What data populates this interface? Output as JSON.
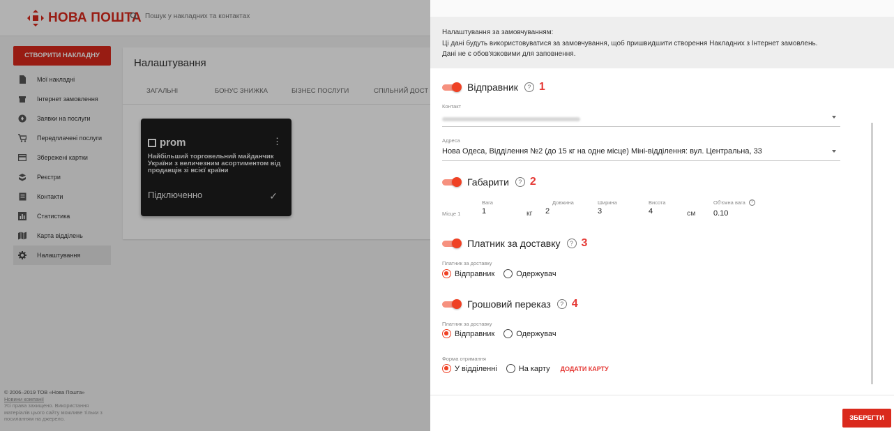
{
  "app": {
    "logo_text": "НОВА ПОШТА",
    "search_placeholder": "Пошук у накладних та контактах",
    "brand_color": "#da291c"
  },
  "sidebar": {
    "create_button": "СТВОРИТИ НАКЛАДНУ",
    "items": [
      {
        "label": "Мої накладні",
        "icon": "document-icon"
      },
      {
        "label": "Інтернет замовлення",
        "icon": "cart-icon"
      },
      {
        "label": "Заявки на послуги",
        "icon": "services-icon"
      },
      {
        "label": "Передплачені послуги",
        "icon": "shopping-cart-icon"
      },
      {
        "label": "Збережені картки",
        "icon": "credit-card-icon"
      },
      {
        "label": "Реєстри",
        "icon": "registry-icon"
      },
      {
        "label": "Контакти",
        "icon": "contacts-icon"
      },
      {
        "label": "Статистика",
        "icon": "chart-icon"
      },
      {
        "label": "Карта відділень",
        "icon": "map-icon"
      },
      {
        "label": "Налаштування",
        "icon": "gear-icon",
        "active": true
      }
    ],
    "footer": {
      "copyright": "© 2006–2019 ТОВ «Нова Пошта»",
      "link": "Новини компанії",
      "fine_print": "Усі права захищено. Використання матеріалів цього сайту можливе тільки з посиланням на джерело."
    }
  },
  "main": {
    "title": "Налаштування",
    "tabs": [
      "ЗАГАЛЬНІ",
      "БОНУС ЗНИЖКА",
      "БІЗНЕС ПОСЛУГИ",
      "СПІЛЬНИЙ ДОСТ"
    ],
    "card": {
      "logo": "prom",
      "description": "Найбільший торговельний майданчик України з величезним асортиментом від продавців зі всієї країни",
      "status": "Підключенно"
    }
  },
  "panel": {
    "info_title": "Налаштування за замовчуванням:",
    "info_text_1": "Ці дані будуть використовуватися за замовчування, щоб пришвидшити створення Накладних з Інтернет замовлень.",
    "info_text_2": "Дані не є обов'язковими для заповнення.",
    "sender": {
      "title": "Відправник",
      "number": "1",
      "contact_label": "Контакт",
      "address_label": "Адреса",
      "address_value": "Нова Одеса, Відділення №2 (до 15 кг на одне місце) Міні-відділення: вул. Центральна, 33"
    },
    "dimensions": {
      "title": "Габарити",
      "number": "2",
      "row_label": "Місце 1",
      "weight_label": "Вага",
      "weight": "1",
      "weight_unit": "кг",
      "length_label": "Довжина",
      "length": "2",
      "width_label": "Ширина",
      "width": "3",
      "height_label": "Висота",
      "height": "4",
      "size_unit": "см",
      "volume_label": "Об'ємна вага",
      "volume": "0.10"
    },
    "payer": {
      "title": "Платник за доставку",
      "number": "3",
      "label": "Платник за доставку",
      "options": [
        "Відправник",
        "Одержувач"
      ],
      "selected": "Відправник"
    },
    "money_transfer": {
      "title": "Грошовий переказ",
      "number": "4",
      "payer_label": "Платник за доставку",
      "payer_options": [
        "Відправник",
        "Одержувач"
      ],
      "payer_selected": "Відправник",
      "form_label": "Форма отримання",
      "form_options": [
        "У відділенні",
        "На карту"
      ],
      "form_selected": "У відділенні",
      "add_card": "ДОДАТИ КАРТУ"
    },
    "save_button": "ЗБЕРЕГТИ",
    "accent_color": "#ef4124"
  }
}
